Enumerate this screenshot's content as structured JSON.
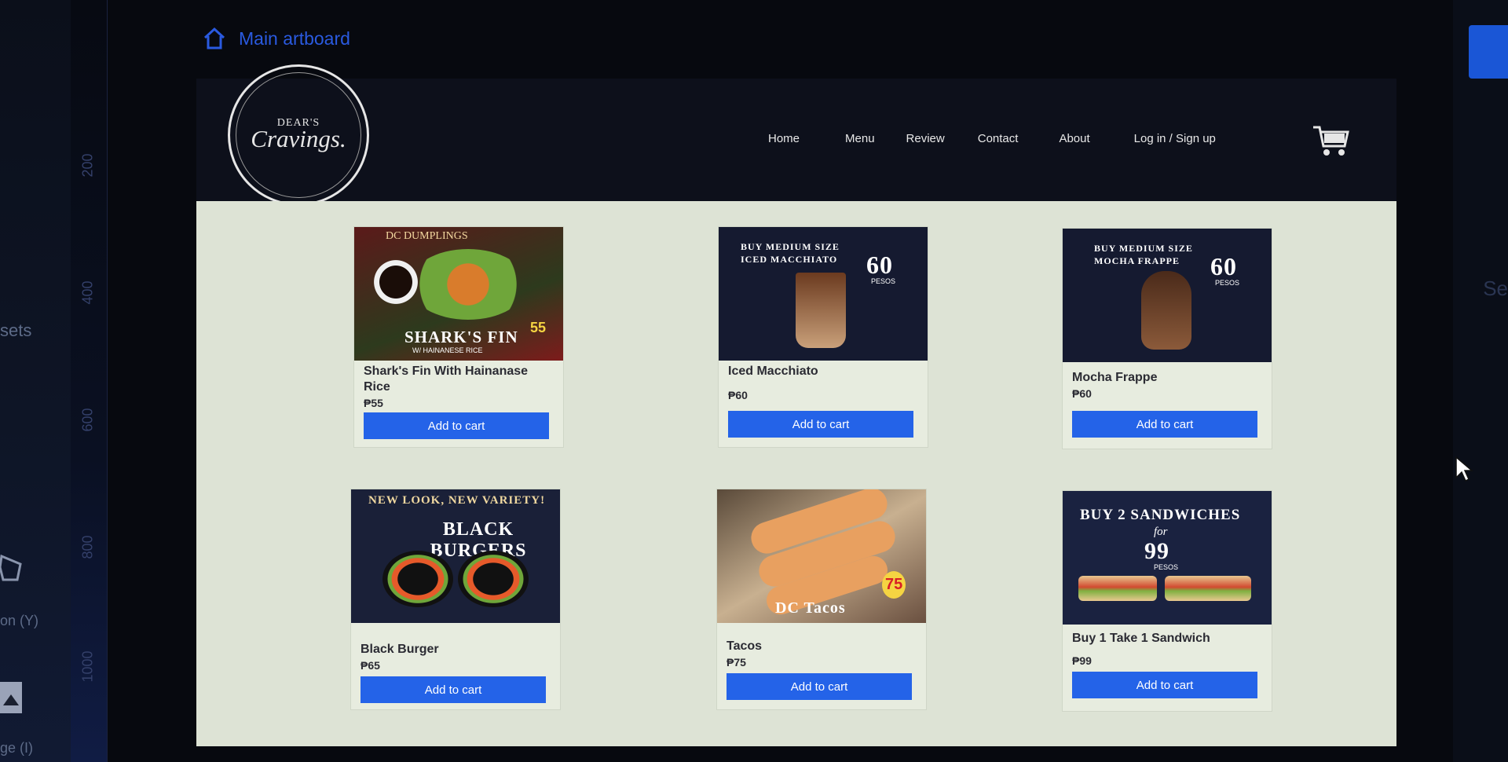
{
  "editor": {
    "artboard_label": "Main artboard",
    "left_panel": {
      "assets_label": "sets",
      "polygon_label": "on (Y)",
      "image_label": "ge (I)"
    },
    "ruler_ticks": [
      "200",
      "400",
      "600",
      "800",
      "1000"
    ],
    "right_panel_text": "Se"
  },
  "site": {
    "logo": {
      "top_text": "DEAR'S",
      "main_text": "Cravings."
    },
    "nav": [
      "Home",
      "Menu",
      "Review",
      "Contact",
      "About",
      "Log in / Sign up"
    ]
  },
  "products": [
    {
      "name": "Shark's Fin With Hainanase Rice",
      "price": "₱55",
      "button": "Add to cart",
      "image_text": {
        "top": "DC DUMPLINGS",
        "headline": "SHARK'S FIN",
        "sub": "W/ HAINANESE RICE",
        "tag": "55"
      }
    },
    {
      "name": "Iced Macchiato",
      "price": "₱60",
      "button": "Add to cart",
      "image_text": {
        "top": "BUY MEDIUM SIZE",
        "headline": "ICED MACCHIATO",
        "big": "60",
        "unit": "PESOS"
      }
    },
    {
      "name": "Mocha Frappe",
      "price": "₱60",
      "button": "Add to cart",
      "image_text": {
        "top": "BUY MEDIUM SIZE",
        "headline": "MOCHA FRAPPE",
        "big": "60",
        "unit": "PESOS"
      }
    },
    {
      "name": "Black Burger",
      "price": "₱65",
      "button": "Add to cart",
      "image_text": {
        "top": "NEW LOOK, NEW VARIETY!",
        "headline": "BLACK BURGERS"
      }
    },
    {
      "name": "Tacos",
      "price": "₱75",
      "button": "Add to cart",
      "image_text": {
        "headline": "DC Tacos",
        "tag": "75"
      }
    },
    {
      "name": "Buy 1 Take 1 Sandwich",
      "price": "₱99",
      "button": "Add to cart",
      "image_text": {
        "top": "BUY 2 SANDWICHES",
        "mid": "for",
        "big": "99",
        "unit": "PESOS"
      }
    }
  ],
  "colors": {
    "button": "#2463e8",
    "content_bg": "#dde3d5",
    "header_bg": "#0d101b",
    "accent": "#2a5ae0"
  }
}
